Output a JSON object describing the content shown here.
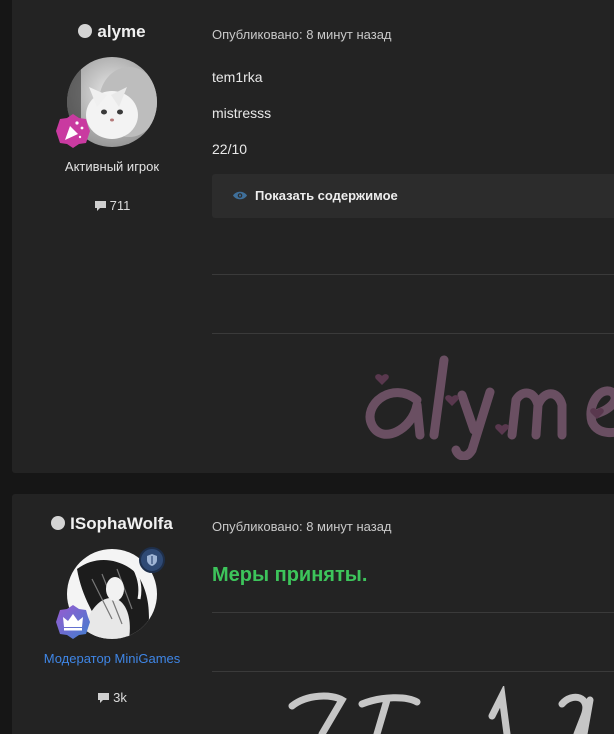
{
  "posts": [
    {
      "author": "alyme",
      "group_title": "Активный игрок",
      "post_count": "711",
      "meta": "Опубликовано: 8 минут назад",
      "lines": [
        "tem1rka",
        "mistresss",
        "22/10"
      ],
      "spoiler_label": "Показать содержимое",
      "group_color": "#e2e2e2",
      "badge_color": "#c93aa0"
    },
    {
      "author": "ISophaWolfa",
      "group_title": "Модератор MiniGames",
      "post_count": "3k",
      "meta": "Опубликовано: 8 минут назад",
      "message": "Меры приняты.",
      "group_color": "#3f86e6",
      "message_color": "#3dc45b",
      "badge_color": "#6a58b8"
    }
  ],
  "icons": {
    "online": "status-dot-icon",
    "comments": "speech-bubble-icon",
    "eye": "eye-icon",
    "moderator": "shield-icon",
    "rank1": "confetti-icon",
    "rank2": "crown-icon"
  }
}
